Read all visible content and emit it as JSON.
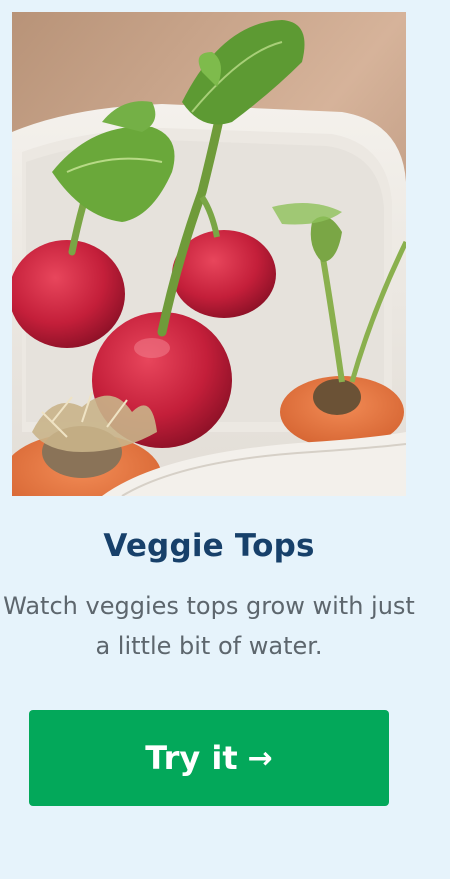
{
  "card": {
    "image_alt": "Radish and carrot tops sprouting in a dish of water",
    "title": "Veggie Tops",
    "description": "Watch veggies tops grow with just a little bit of water.",
    "button_label": "Try it",
    "button_icon": "arrow-right-icon"
  },
  "colors": {
    "background": "#e6f3fb",
    "title": "#17406a",
    "description": "#5d666d",
    "button": "#03a85a",
    "button_text": "#ffffff"
  }
}
